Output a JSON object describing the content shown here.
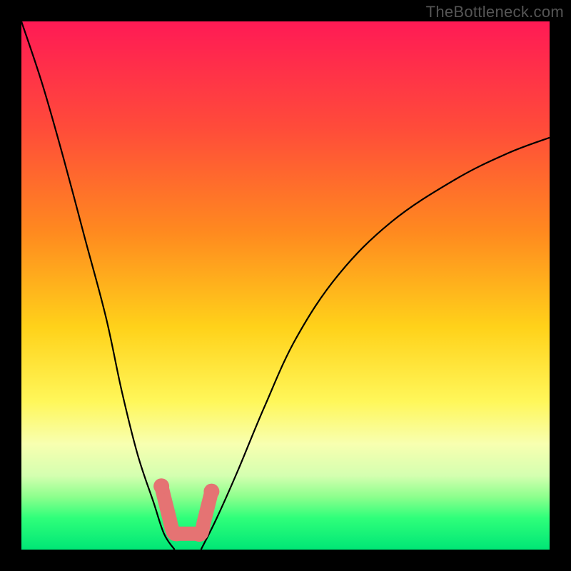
{
  "watermark": "TheBottleneck.com",
  "chart_data": {
    "type": "line",
    "title": "",
    "xlabel": "",
    "ylabel": "",
    "xlim": [
      0,
      100
    ],
    "ylim": [
      0,
      100
    ],
    "gradient_stops": [
      {
        "offset": 0,
        "color": "#ff1a55"
      },
      {
        "offset": 20,
        "color": "#ff4b3a"
      },
      {
        "offset": 40,
        "color": "#ff8a1f"
      },
      {
        "offset": 58,
        "color": "#ffd21a"
      },
      {
        "offset": 72,
        "color": "#fff75a"
      },
      {
        "offset": 80,
        "color": "#f8ffb0"
      },
      {
        "offset": 86,
        "color": "#d4ffb0"
      },
      {
        "offset": 90,
        "color": "#8dff8d"
      },
      {
        "offset": 94,
        "color": "#2fff7a"
      },
      {
        "offset": 100,
        "color": "#00e676"
      }
    ],
    "series": [
      {
        "name": "curve-left",
        "x": [
          0,
          4,
          8,
          12,
          16,
          19,
          22,
          25,
          27,
          29
        ],
        "y": [
          100,
          88,
          74,
          59,
          44,
          30,
          18,
          9,
          3,
          0
        ]
      },
      {
        "name": "curve-right",
        "x": [
          34,
          37,
          41,
          46,
          52,
          60,
          70,
          82,
          92,
          100
        ],
        "y": [
          0,
          6,
          15,
          27,
          40,
          52,
          62,
          70,
          75,
          78
        ]
      },
      {
        "name": "highlight-segment",
        "color": "#e57373",
        "points": [
          {
            "x": 26.5,
            "y": 12
          },
          {
            "x": 27.0,
            "y": 10
          },
          {
            "x": 27.5,
            "y": 8
          },
          {
            "x": 28.0,
            "y": 6
          },
          {
            "x": 28.5,
            "y": 4
          },
          {
            "x": 29.0,
            "y": 3
          },
          {
            "x": 30.0,
            "y": 3
          },
          {
            "x": 31.0,
            "y": 3
          },
          {
            "x": 32.0,
            "y": 3
          },
          {
            "x": 33.0,
            "y": 3
          },
          {
            "x": 34.0,
            "y": 3
          },
          {
            "x": 34.5,
            "y": 5
          },
          {
            "x": 35.0,
            "y": 7
          },
          {
            "x": 35.5,
            "y": 9
          },
          {
            "x": 36.0,
            "y": 11
          }
        ]
      }
    ]
  }
}
